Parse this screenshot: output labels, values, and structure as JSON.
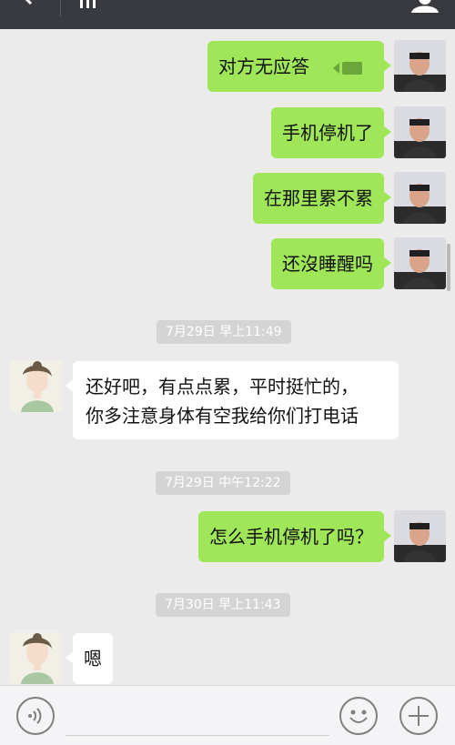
{
  "header": {
    "back_icon": "back-arrow-icon",
    "tab_icon": "bars-icon",
    "profile_icon": "person-icon",
    "background_color": "#393a3f"
  },
  "colors": {
    "outgoing_bubble": "#9fe658",
    "incoming_bubble": "#ffffff",
    "chat_background": "#ebebeb",
    "timestamp_bg": "#d4d4d4"
  },
  "messages": [
    {
      "direction": "out",
      "text": "对方无应答",
      "icon": "video-call-icon"
    },
    {
      "direction": "out",
      "text": "手机停机了"
    },
    {
      "direction": "out",
      "text": "在那里累不累"
    },
    {
      "direction": "out",
      "text": "还沒睡醒吗"
    },
    {
      "timestamp": "7月29日 早上11:49"
    },
    {
      "direction": "in",
      "lines": [
        "还好吧，有点点累，平时挺忙的，",
        "你多注意身体有空我给你们打电话"
      ]
    },
    {
      "timestamp": "7月29日 中午12:22"
    },
    {
      "direction": "out",
      "text": "怎么手机停机了吗？"
    },
    {
      "timestamp": "7月30日 早上11:43"
    },
    {
      "direction": "in",
      "text": "嗯"
    }
  ],
  "input_bar": {
    "voice_icon": "voice-icon",
    "emoji_icon": "emoji-icon",
    "plus_icon": "plus-icon"
  }
}
